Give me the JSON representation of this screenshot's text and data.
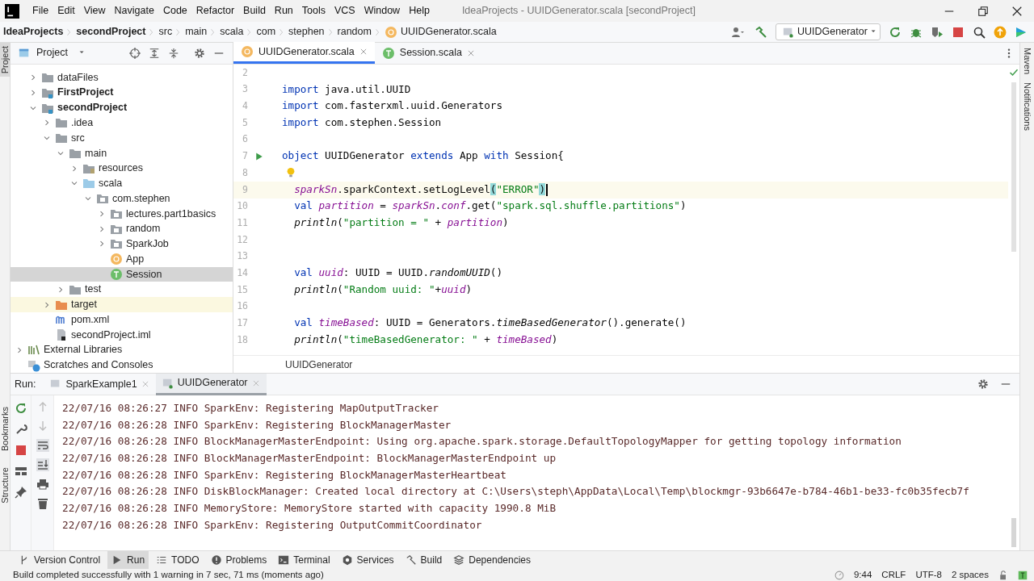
{
  "title_bar": {
    "menu": [
      "File",
      "Edit",
      "View",
      "Navigate",
      "Code",
      "Refactor",
      "Build",
      "Run",
      "Tools",
      "VCS",
      "Window",
      "Help"
    ],
    "title": "IdeaProjects - UUIDGenerator.scala [secondProject]"
  },
  "nav_bar": {
    "breadcrumbs": [
      {
        "label": "IdeaProjects",
        "kind": "project"
      },
      {
        "label": "secondProject",
        "kind": "project"
      },
      {
        "label": "src",
        "kind": "folder"
      },
      {
        "label": "main",
        "kind": "folder"
      },
      {
        "label": "scala",
        "kind": "folder"
      },
      {
        "label": "com",
        "kind": "folder"
      },
      {
        "label": "stephen",
        "kind": "folder"
      },
      {
        "label": "random",
        "kind": "folder"
      },
      {
        "label": "UUIDGenerator.scala",
        "kind": "file"
      }
    ],
    "run_config": "UUIDGenerator"
  },
  "side_labels": {
    "left_top": "Project",
    "left_bottom": [
      "Bookmarks",
      "Structure"
    ],
    "right": [
      "Maven",
      "Notifications"
    ]
  },
  "project_panel": {
    "title": "Project",
    "tree": [
      {
        "children": [
          {
            "label": "dataFiles",
            "kind": "folder",
            "expanded": false,
            "selected": false
          },
          {
            "label": "FirstProject",
            "kind": "module",
            "expanded": false,
            "selected": false
          },
          {
            "label": "secondProject",
            "kind": "module",
            "expanded": true,
            "selected": false,
            "children": [
              {
                "label": ".idea",
                "kind": "folder",
                "expanded": false,
                "selected": false
              },
              {
                "label": "src",
                "kind": "folder",
                "expanded": true,
                "selected": false,
                "children": [
                  {
                    "label": "main",
                    "kind": "folder",
                    "expanded": true,
                    "selected": false,
                    "children": [
                      {
                        "label": "resources",
                        "kind": "resources",
                        "expanded": false,
                        "selected": false
                      },
                      {
                        "label": "scala",
                        "kind": "source",
                        "expanded": true,
                        "selected": false,
                        "children": [
                          {
                            "label": "com.stephen",
                            "kind": "package",
                            "expanded": true,
                            "selected": false,
                            "children": [
                              {
                                "label": "lectures.part1basics",
                                "kind": "package",
                                "expanded": false,
                                "selected": false
                              },
                              {
                                "label": "random",
                                "kind": "package",
                                "expanded": false,
                                "selected": false
                              },
                              {
                                "label": "SparkJob",
                                "kind": "package",
                                "expanded": false,
                                "selected": false
                              },
                              {
                                "label": "App",
                                "kind": "object",
                                "selected": false
                              },
                              {
                                "label": "Session",
                                "kind": "trait",
                                "selected": true
                              }
                            ]
                          }
                        ]
                      }
                    ]
                  },
                  {
                    "label": "test",
                    "kind": "folder",
                    "expanded": false,
                    "selected": false
                  }
                ]
              },
              {
                "label": "target",
                "kind": "excluded",
                "expanded": false,
                "selected": false
              },
              {
                "label": "pom.xml",
                "kind": "maven",
                "selected": false
              },
              {
                "label": "secondProject.iml",
                "kind": "iml",
                "selected": false
              }
            ]
          }
        ]
      },
      {
        "label": "External Libraries",
        "kind": "libraries",
        "expanded": false,
        "selected": false
      },
      {
        "label": "Scratches and Consoles",
        "kind": "scratches",
        "selected": false
      }
    ]
  },
  "editor": {
    "tabs": [
      {
        "label": "UUIDGenerator.scala",
        "kind": "object",
        "selected": true
      },
      {
        "label": "Session.scala",
        "kind": "trait",
        "selected": false
      }
    ],
    "lines": [
      {
        "number": "2",
        "kind": "code",
        "current": false
      },
      {
        "number": "3",
        "kind": "code",
        "current": false,
        "tokens": [
          {
            "text": "import",
            "kind": "kw"
          },
          {
            "text": " java.util.UUID",
            "kind": "plain"
          }
        ]
      },
      {
        "number": "4",
        "kind": "code",
        "current": false,
        "tokens": [
          {
            "text": "import",
            "kind": "kw"
          },
          {
            "text": " com.fasterxml.uuid.Generators",
            "kind": "plain"
          }
        ]
      },
      {
        "number": "5",
        "kind": "code",
        "current": false,
        "tokens": [
          {
            "text": "import",
            "kind": "kw"
          },
          {
            "text": " com.stephen.Session",
            "kind": "plain"
          }
        ]
      },
      {
        "number": "6",
        "kind": "code",
        "current": false
      },
      {
        "number": "7",
        "kind": "run",
        "current": false,
        "tokens": [
          {
            "text": "object",
            "kind": "kw"
          },
          {
            "text": " UUIDGenerator ",
            "kind": "plain"
          },
          {
            "text": "extends",
            "kind": "kw"
          },
          {
            "text": " App ",
            "kind": "plain"
          },
          {
            "text": "with",
            "kind": "kw"
          },
          {
            "text": " Session{",
            "kind": "plain"
          }
        ]
      },
      {
        "number": "8",
        "kind": "bulb",
        "current": false
      },
      {
        "number": "9",
        "kind": "code",
        "current": true,
        "tokens": [
          {
            "text": "  sparkSn",
            "kind": "field"
          },
          {
            "text": ".sparkContext.setLogLevel",
            "kind": "plain"
          },
          {
            "text": "(",
            "kind": "match"
          },
          {
            "text": "\"ERROR\"",
            "kind": "str"
          },
          {
            "text": ")",
            "kind": "match"
          }
        ]
      },
      {
        "number": "10",
        "kind": "code",
        "current": false,
        "tokens": [
          {
            "text": "  val",
            "kind": "kw"
          },
          {
            "text": " partition",
            "kind": "field"
          },
          {
            "text": " = ",
            "kind": "plain"
          },
          {
            "text": "sparkSn",
            "kind": "field"
          },
          {
            "text": ".",
            "kind": "plain"
          },
          {
            "text": "conf",
            "kind": "field"
          },
          {
            "text": ".get(",
            "kind": "plain"
          },
          {
            "text": "\"spark.sql.shuffle.partitions\"",
            "kind": "str"
          },
          {
            "text": ")",
            "kind": "plain"
          }
        ]
      },
      {
        "number": "11",
        "kind": "code",
        "current": false,
        "tokens": [
          {
            "text": "  println",
            "kind": "fn"
          },
          {
            "text": "(",
            "kind": "plain"
          },
          {
            "text": "\"partition = \"",
            "kind": "str"
          },
          {
            "text": " + ",
            "kind": "plain"
          },
          {
            "text": "partition",
            "kind": "field"
          },
          {
            "text": ")",
            "kind": "plain"
          }
        ]
      },
      {
        "number": "12",
        "kind": "code",
        "current": false
      },
      {
        "number": "13",
        "kind": "code",
        "current": false
      },
      {
        "number": "14",
        "kind": "code",
        "current": false,
        "tokens": [
          {
            "text": "  val",
            "kind": "kw"
          },
          {
            "text": " uuid",
            "kind": "field"
          },
          {
            "text": ": UUID = UUID.",
            "kind": "plain"
          },
          {
            "text": "randomUUID",
            "kind": "fn"
          },
          {
            "text": "()",
            "kind": "plain"
          }
        ]
      },
      {
        "number": "15",
        "kind": "code",
        "current": false,
        "tokens": [
          {
            "text": "  println",
            "kind": "fn"
          },
          {
            "text": "(",
            "kind": "plain"
          },
          {
            "text": "\"Random uuid: \"",
            "kind": "str"
          },
          {
            "text": "+",
            "kind": "plain"
          },
          {
            "text": "uuid",
            "kind": "field"
          },
          {
            "text": ")",
            "kind": "plain"
          }
        ]
      },
      {
        "number": "16",
        "kind": "code",
        "current": false
      },
      {
        "number": "17",
        "kind": "code",
        "current": false,
        "tokens": [
          {
            "text": "  val",
            "kind": "kw"
          },
          {
            "text": " timeBased",
            "kind": "field"
          },
          {
            "text": ": UUID = Generators.",
            "kind": "plain"
          },
          {
            "text": "timeBasedGenerator",
            "kind": "fn"
          },
          {
            "text": "().generate()",
            "kind": "plain"
          }
        ]
      },
      {
        "number": "18",
        "kind": "code",
        "current": false,
        "tokens": [
          {
            "text": "  println",
            "kind": "fn"
          },
          {
            "text": "(",
            "kind": "plain"
          },
          {
            "text": "\"timeBasedGenerator: \"",
            "kind": "str"
          },
          {
            "text": " + ",
            "kind": "plain"
          },
          {
            "text": "timeBased",
            "kind": "field"
          },
          {
            "text": ")",
            "kind": "plain"
          }
        ]
      }
    ],
    "breadcrumb": "UUIDGenerator"
  },
  "run_panel": {
    "label": "Run:",
    "tabs": [
      {
        "label": "SparkExample1",
        "selected": false
      },
      {
        "label": "UUIDGenerator",
        "selected": true
      }
    ],
    "lines": [
      "22/07/16 08:26:27 INFO SparkEnv: Registering MapOutputTracker",
      "22/07/16 08:26:28 INFO SparkEnv: Registering BlockManagerMaster",
      "22/07/16 08:26:28 INFO BlockManagerMasterEndpoint: Using org.apache.spark.storage.DefaultTopologyMapper for getting topology information",
      "22/07/16 08:26:28 INFO BlockManagerMasterEndpoint: BlockManagerMasterEndpoint up",
      "22/07/16 08:26:28 INFO SparkEnv: Registering BlockManagerMasterHeartbeat",
      "22/07/16 08:26:28 INFO DiskBlockManager: Created local directory at C:\\Users\\steph\\AppData\\Local\\Temp\\blockmgr-93b6647e-b784-46b1-be33-fc0b35fecb7f",
      "22/07/16 08:26:28 INFO MemoryStore: MemoryStore started with capacity 1990.8 MiB",
      "22/07/16 08:26:28 INFO SparkEnv: Registering OutputCommitCoordinator"
    ]
  },
  "tool_tabs": [
    {
      "label": "Version Control",
      "kind": "vcs",
      "selected": false
    },
    {
      "label": "Run",
      "kind": "run",
      "selected": true
    },
    {
      "label": "TODO",
      "kind": "todo",
      "selected": false
    },
    {
      "label": "Problems",
      "kind": "problems",
      "selected": false
    },
    {
      "label": "Terminal",
      "kind": "terminal",
      "selected": false
    },
    {
      "label": "Services",
      "kind": "services",
      "selected": false
    },
    {
      "label": "Build",
      "kind": "build",
      "selected": false
    },
    {
      "label": "Dependencies",
      "kind": "dependencies",
      "selected": false
    }
  ],
  "status_bar": {
    "message": "Build completed successfully with 1 warning in 7 sec, 71 ms (moments ago)",
    "items": [
      "9:44",
      "CRLF",
      "UTF-8",
      "2 spaces"
    ]
  }
}
